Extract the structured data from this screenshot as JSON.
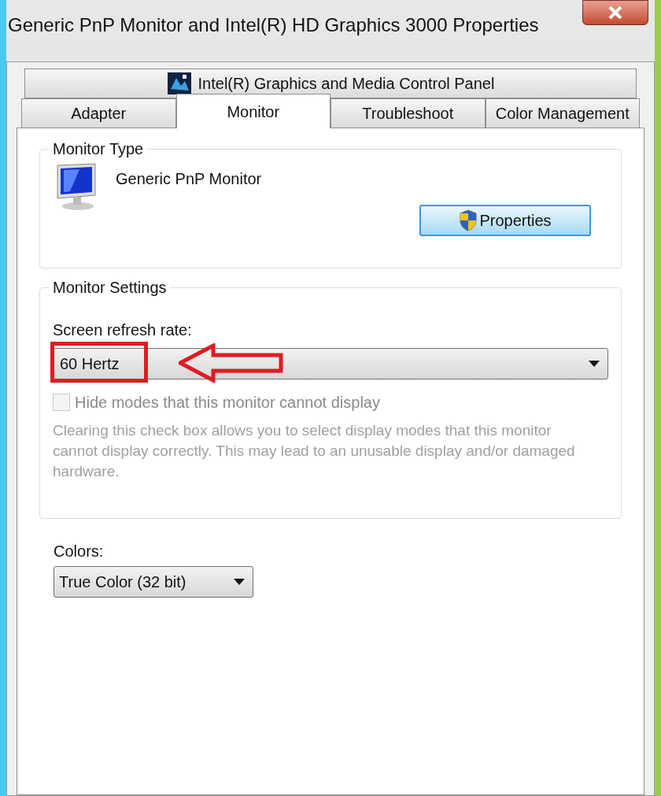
{
  "window": {
    "title": "Generic PnP Monitor and Intel(R) HD Graphics 3000 Properties"
  },
  "tab_rows": [
    [
      {
        "label": "Intel(R) Graphics and Media Control Panel",
        "selected": false,
        "kind": "intel"
      }
    ],
    [
      {
        "label": "Adapter",
        "selected": false
      },
      {
        "label": "Monitor",
        "selected": true
      },
      {
        "label": "Troubleshoot",
        "selected": false
      },
      {
        "label": "Color Management",
        "selected": false
      }
    ]
  ],
  "monitor_type": {
    "legend": "Monitor Type",
    "name": "Generic PnP Monitor",
    "button": "Properties"
  },
  "monitor_settings": {
    "legend": "Monitor Settings",
    "refresh_label": "Screen refresh rate:",
    "refresh_value": "60 Hertz",
    "checkbox": {
      "label": "Hide modes that this monitor cannot display",
      "checked": false,
      "disabled": true
    },
    "note": "Clearing this check box allows you to select display modes that this monitor cannot display correctly. This may lead to an unusable display and/or damaged hardware."
  },
  "colors": {
    "label": "Colors:",
    "value": "True Color (32 bit)"
  }
}
